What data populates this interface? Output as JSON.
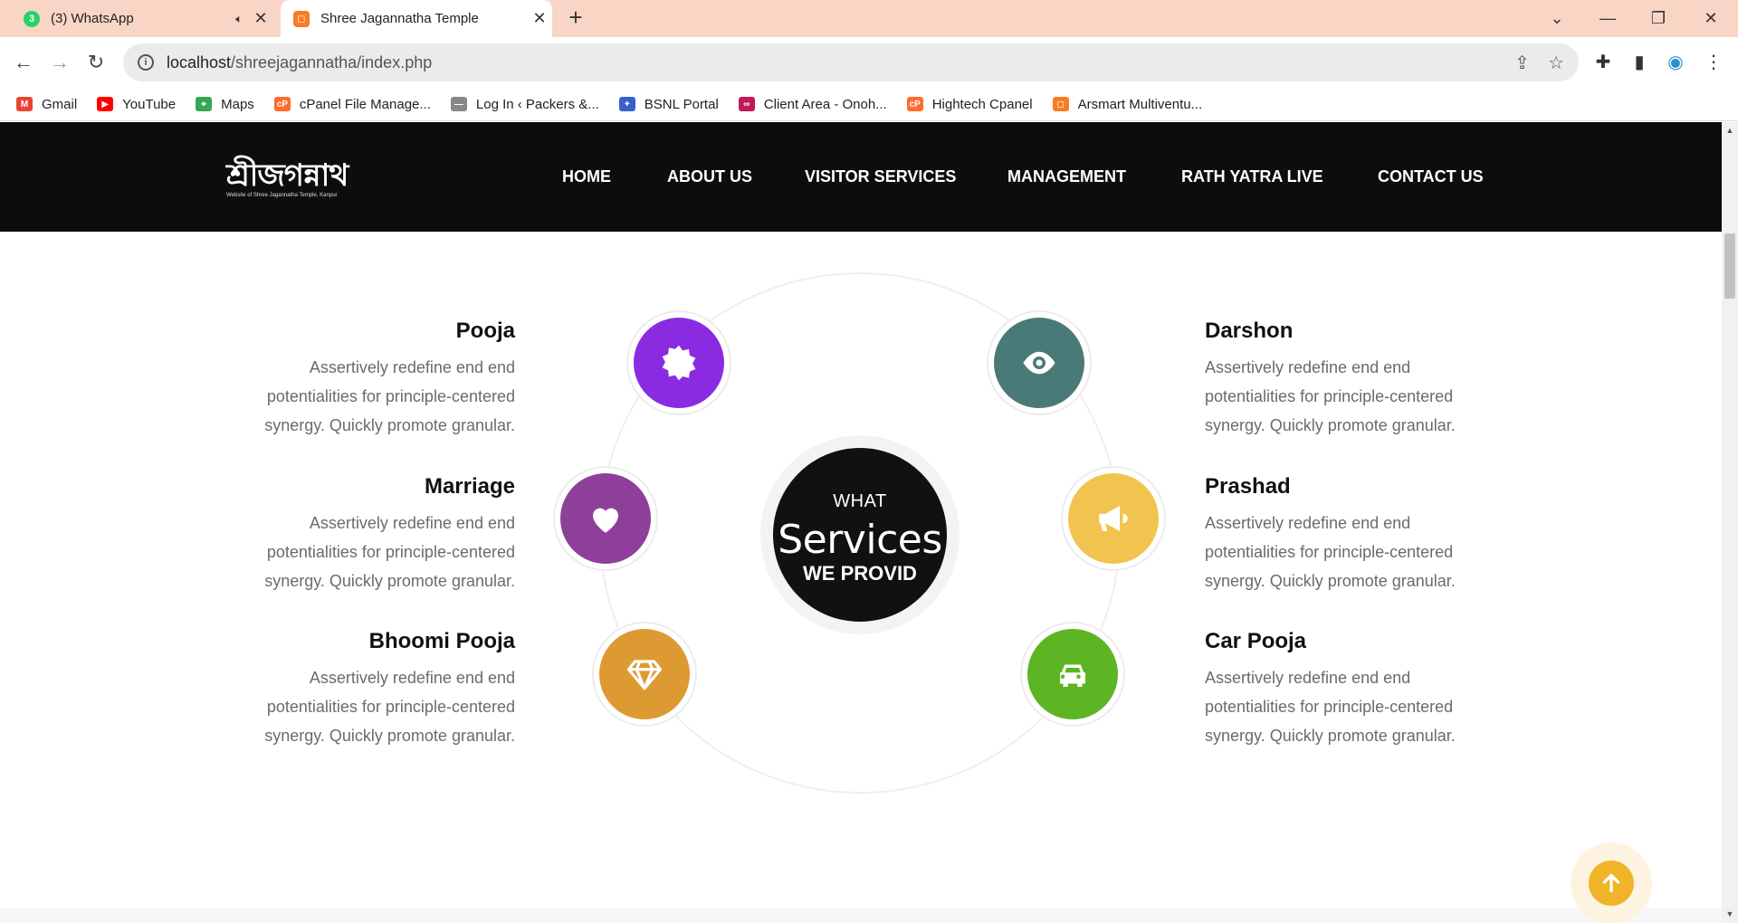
{
  "browser": {
    "tabs": [
      {
        "title": "(3) WhatsApp",
        "badge": "3",
        "active": false
      },
      {
        "title": "Shree Jagannatha Temple",
        "active": true
      }
    ],
    "url_host": "localhost",
    "url_path": "/shreejagannatha/index.php",
    "bookmarks": [
      {
        "label": "Gmail",
        "icon": "gmail-icon",
        "color": "#ea4335"
      },
      {
        "label": "YouTube",
        "icon": "youtube-icon",
        "color": "#ff0000"
      },
      {
        "label": "Maps",
        "icon": "maps-icon",
        "color": "#34a853"
      },
      {
        "label": "cPanel File Manage...",
        "icon": "cpanel-icon",
        "color": "#ff6c2c"
      },
      {
        "label": "Log In ‹ Packers &...",
        "icon": "dash-icon",
        "color": "#888888"
      },
      {
        "label": "BSNL Portal",
        "icon": "bsnl-icon",
        "color": "#3a5fcd"
      },
      {
        "label": "Client Area - Onoh...",
        "icon": "onoh-icon",
        "color": "#c2185b"
      },
      {
        "label": "Hightech Cpanel",
        "icon": "cpanel-icon",
        "color": "#ff6c2c"
      },
      {
        "label": "Arsmart Multiventu...",
        "icon": "xampp-icon",
        "color": "#fb7a24"
      }
    ]
  },
  "site": {
    "logo_text": "শ্রীজগন্নাথ",
    "logo_sub": "Website of Shree Jagannatha Temple, Kanpur",
    "nav": [
      "HOME",
      "ABOUT US",
      "VISITOR SERVICES",
      "MANAGEMENT",
      "RATH YATRA LIVE",
      "CONTACT US"
    ],
    "center": {
      "line1": "WHAT",
      "line2": "Services",
      "line3": "WE PROVID"
    },
    "services_left": [
      {
        "title": "Pooja",
        "text": "Assertively redefine end end potentialities for principle-centered synergy. Quickly promote granular.",
        "color": "#8a2be2",
        "icon": "badge-icon"
      },
      {
        "title": "Marriage",
        "text": "Assertively redefine end end potentialities for principle-centered synergy. Quickly promote granular.",
        "color": "#8e3f99",
        "icon": "heart-icon"
      },
      {
        "title": "Bhoomi Pooja",
        "text": "Assertively redefine end end potentialities for principle-centered synergy. Quickly promote granular.",
        "color": "#dd9a33",
        "icon": "diamond-icon"
      }
    ],
    "services_right": [
      {
        "title": "Darshon",
        "text": "Assertively redefine end end potentialities for principle-centered synergy. Quickly promote granular.",
        "color": "#4a7a78",
        "icon": "eye-icon"
      },
      {
        "title": "Prashad",
        "text": "Assertively redefine end end potentialities for principle-centered synergy. Quickly promote granular.",
        "color": "#f0c44e",
        "icon": "megaphone-icon"
      },
      {
        "title": "Car Pooja",
        "text": "Assertively redefine end end potentialities for principle-centered synergy. Quickly promote granular.",
        "color": "#5db523",
        "icon": "car-icon"
      }
    ]
  }
}
